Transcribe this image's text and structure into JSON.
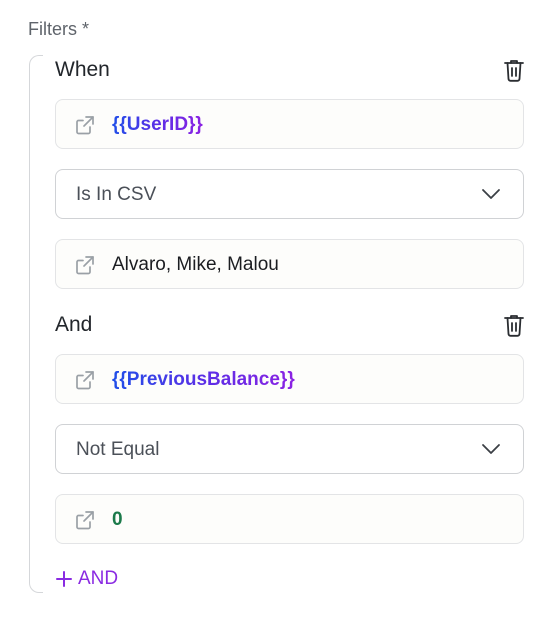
{
  "section": {
    "label": "Filters *"
  },
  "conditions": [
    {
      "label": "When",
      "field": "{{UserID}}",
      "operator": "Is In CSV",
      "value": "Alvaro, Mike, Malou"
    },
    {
      "label": "And",
      "field": "{{PreviousBalance}}",
      "operator": "Not Equal",
      "value": "0"
    }
  ],
  "add_and": {
    "label": "AND",
    "icon": "plus-icon"
  },
  "colors": {
    "accent": "#8a2be2",
    "variable_start": "#1f4ee8",
    "variable_end": "#8b22e3",
    "number": "#1b7a4a",
    "border": "#d0d2d5"
  },
  "icons": {
    "delete": "trash-icon",
    "open": "external-link-icon",
    "dropdown": "chevron-down-icon"
  }
}
